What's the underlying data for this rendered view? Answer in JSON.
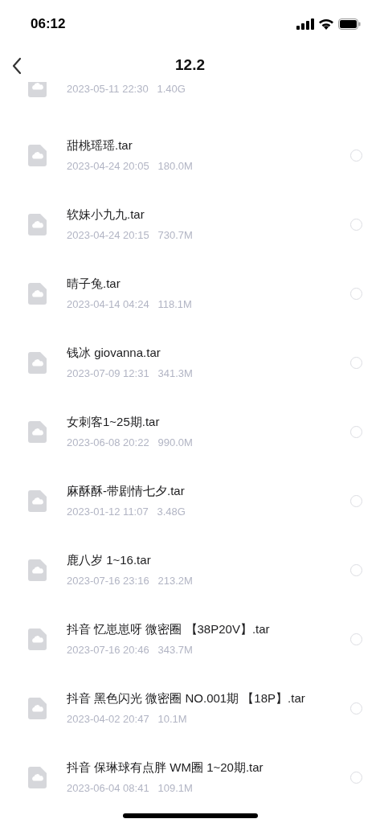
{
  "status_bar": {
    "time": "06:12"
  },
  "nav": {
    "title": "12.2"
  },
  "files": [
    {
      "date": "2023-05-11 22:30",
      "size": "1.40G"
    },
    {
      "name": "甜桃瑶瑶.tar",
      "date": "2023-04-24 20:05",
      "size": "180.0M",
      "selected": false
    },
    {
      "name": "软妹小九九.tar",
      "date": "2023-04-24 20:15",
      "size": "730.7M",
      "selected": false
    },
    {
      "name": "晴子兔.tar",
      "date": "2023-04-14 04:24",
      "size": "118.1M",
      "selected": false
    },
    {
      "name": "钱冰 giovanna.tar",
      "date": "2023-07-09 12:31",
      "size": "341.3M",
      "selected": false
    },
    {
      "name": "女刺客1~25期.tar",
      "date": "2023-06-08 20:22",
      "size": "990.0M",
      "selected": false
    },
    {
      "name": "麻酥酥-带剧情七夕.tar",
      "date": "2023-01-12 11:07",
      "size": "3.48G",
      "selected": false
    },
    {
      "name": "鹿八岁 1~16.tar",
      "date": "2023-07-16 23:16",
      "size": "213.2M",
      "selected": false
    },
    {
      "name": "抖音 忆崽崽呀 微密圈 【38P20V】.tar",
      "date": "2023-07-16 20:46",
      "size": "343.7M",
      "selected": false
    },
    {
      "name": "抖音 黑色闪光 微密圈 NO.001期 【18P】.tar",
      "date": "2023-04-02 20:47",
      "size": "10.1M",
      "selected": false
    },
    {
      "name": "抖音 保琳球有点胖 WM圈 1~20期.tar",
      "date": "2023-06-04 08:41",
      "size": "109.1M",
      "selected": false
    }
  ]
}
